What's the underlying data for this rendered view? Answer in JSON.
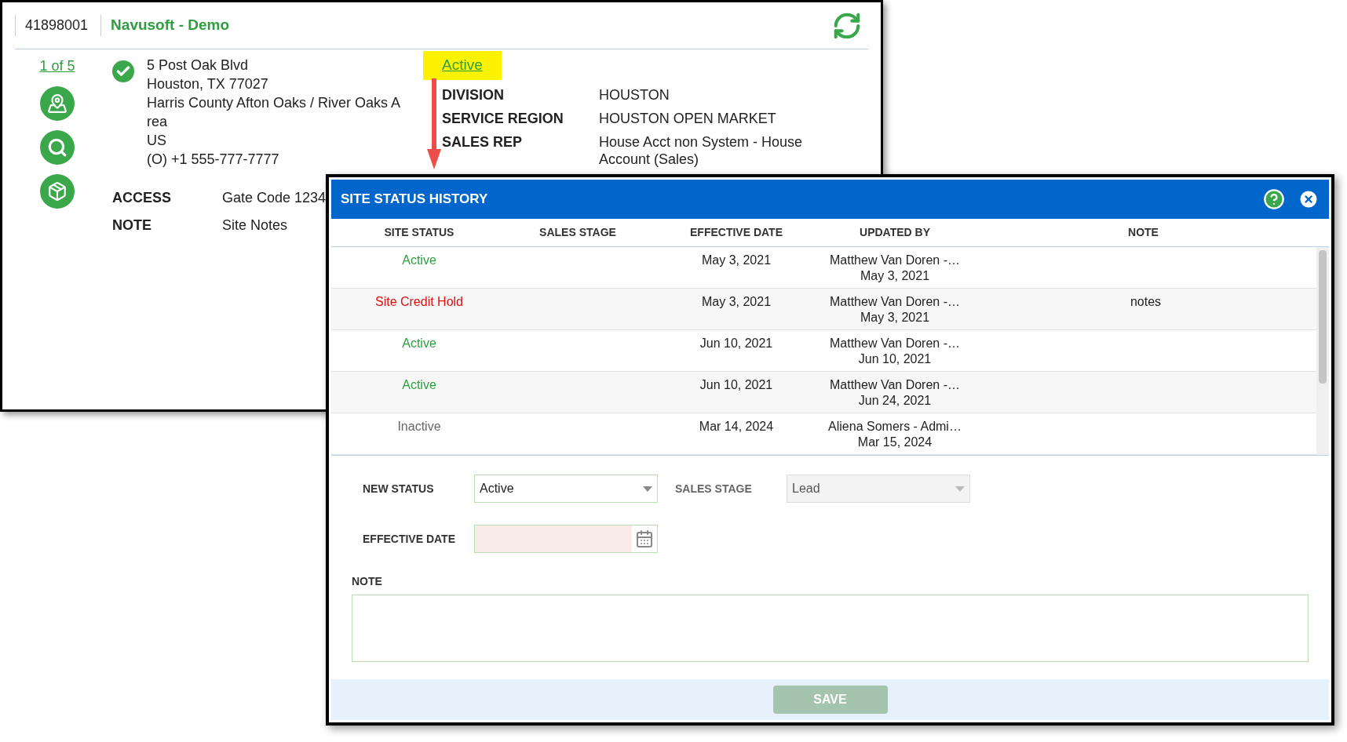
{
  "site_window": {
    "account_number": "41898001",
    "site_name": "Navusoft - Demo",
    "pager": "1 of 5",
    "address_lines": [
      "5 Post Oak Blvd",
      "Houston, TX 77027",
      "Harris County Afton Oaks / River Oaks A",
      "rea",
      "US",
      "(O) +1 555-777-7777"
    ],
    "status_link": "Active",
    "details": [
      {
        "label": "DIVISION",
        "value": "HOUSTON"
      },
      {
        "label": "SERVICE REGION",
        "value": "HOUSTON OPEN MARKET"
      },
      {
        "label": "SALES REP",
        "value": "House Acct non System - House Account (Sales)"
      }
    ],
    "extra": [
      {
        "label": "ACCESS",
        "value": "Gate Code 1234"
      },
      {
        "label": "NOTE",
        "value": "Site Notes"
      }
    ]
  },
  "dialog": {
    "title": "SITE STATUS HISTORY",
    "columns": [
      "SITE STATUS",
      "SALES STAGE",
      "EFFECTIVE DATE",
      "UPDATED BY",
      "NOTE"
    ],
    "rows": [
      {
        "status": "Active",
        "color": "#2e9e3e",
        "effective_date": "May 3, 2021",
        "updated_by": "Matthew Van Doren -…",
        "updated_on": "May 3, 2021",
        "note": ""
      },
      {
        "status": "Site Credit Hold",
        "color": "#e01010",
        "effective_date": "May 3, 2021",
        "updated_by": "Matthew Van Doren -…",
        "updated_on": "May 3, 2021",
        "note": "notes"
      },
      {
        "status": "Active",
        "color": "#2e9e3e",
        "effective_date": "Jun 10, 2021",
        "updated_by": "Matthew Van Doren -…",
        "updated_on": "Jun 10, 2021",
        "note": ""
      },
      {
        "status": "Active",
        "color": "#2e9e3e",
        "effective_date": "Jun 10, 2021",
        "updated_by": "Matthew Van Doren -…",
        "updated_on": "Jun 24, 2021",
        "note": ""
      },
      {
        "status": "Inactive",
        "color": "#666666",
        "effective_date": "Mar 14, 2024",
        "updated_by": "Aliena Somers - Admi…",
        "updated_on": "Mar 15, 2024",
        "note": ""
      }
    ],
    "form": {
      "new_status": {
        "label": "NEW STATUS",
        "value": "Active"
      },
      "sales_stage": {
        "label": "SALES STAGE",
        "value": "Lead",
        "disabled": true
      },
      "effective_date": {
        "label": "EFFECTIVE DATE",
        "invalid": true
      },
      "note": {
        "label": "NOTE"
      }
    },
    "save_button": {
      "label": "SAVE",
      "disabled": true
    }
  }
}
